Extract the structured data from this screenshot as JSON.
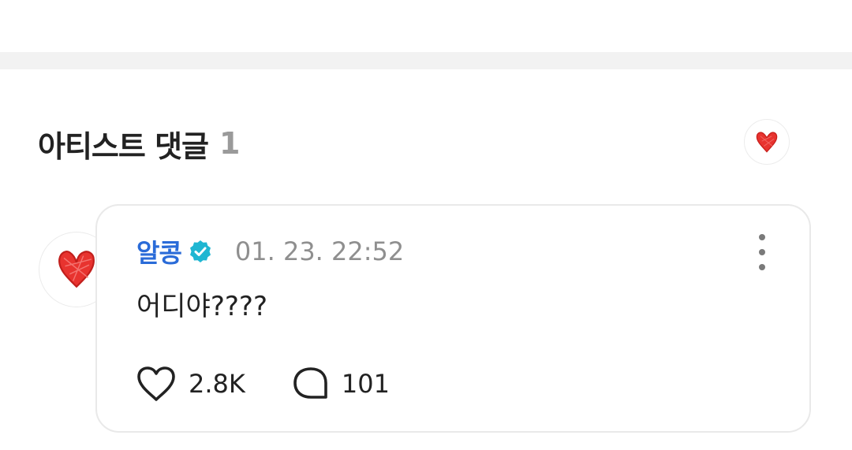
{
  "section": {
    "title": "아티스트 댓글",
    "count": "1"
  },
  "comment": {
    "author": "알콩",
    "timestamp": "01. 23. 22:52",
    "text": "어디야????",
    "likes": "2.8K",
    "replies": "101"
  },
  "icons": {
    "artist_badge": "heart-scribble-icon",
    "avatar": "heart-scribble-icon",
    "verified": "verified-check-icon",
    "like": "heart-outline-icon",
    "reply": "speech-bubble-icon",
    "more": "more-vertical-icon"
  },
  "colors": {
    "author_name": "#2a6bd8",
    "verified_badge": "#1fb6d2",
    "heart_scribble": "#e8332f",
    "count": "#9a9a9a",
    "timestamp": "#8f8f8f",
    "band": "#f2f2f2"
  }
}
